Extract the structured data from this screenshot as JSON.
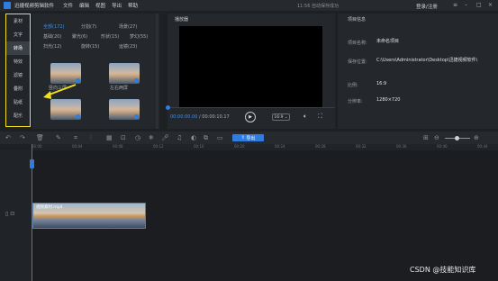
{
  "titlebar": {
    "app_title": "迅捷视频剪辑软件",
    "menu": [
      "文件",
      "编辑",
      "视图",
      "导出",
      "帮助"
    ],
    "save_status": "11:56 自动保存成功",
    "login": "登录/注册"
  },
  "sidebar": {
    "items": [
      "素材",
      "文字",
      "转场",
      "特效",
      "滤镜",
      "叠附",
      "贴纸",
      "配乐"
    ],
    "active_index": 2
  },
  "assets": {
    "filters": [
      [
        "全部(172)",
        "分割(7)",
        "场景(27)"
      ],
      [
        "基础(20)",
        "聚光(6)",
        "形状(15)",
        "梦幻(55)"
      ],
      [
        "扫光(12)",
        "旋转(15)",
        "运镜(23)"
      ]
    ],
    "active_filter": "全部(172)",
    "thumbs": [
      "竖向三屏",
      "左右两屏"
    ]
  },
  "player": {
    "title": "播放器",
    "current_time": "00:00:00.00",
    "total_time": "/ 00:00:10.17",
    "ratio": "16:9"
  },
  "project_info": {
    "title": "项目信息",
    "rows": [
      {
        "label": "项目名称:",
        "value": "未命名项目"
      },
      {
        "label": "保存位置:",
        "value": "C:\\Users\\Administrator\\Desktop\\迅捷视频软件\\"
      },
      {
        "label": "比例:",
        "value": "16:9"
      },
      {
        "label": "分辨率:",
        "value": "1280×720"
      }
    ]
  },
  "toolbar": {
    "export_label": "导出"
  },
  "ruler": {
    "ticks": [
      "00:00",
      "00:04",
      "00:08",
      "00:12",
      "00:16",
      "00:20",
      "00:24",
      "00:28",
      "00:32",
      "00:36",
      "00:40",
      "00:44"
    ]
  },
  "timeline": {
    "clip_name": "视频素材.mp4"
  },
  "watermark": "CSDN @技能知识库",
  "colors": {
    "accent": "#2f7de1",
    "highlight_box": "#f0e01a",
    "background": "#1e2124"
  }
}
